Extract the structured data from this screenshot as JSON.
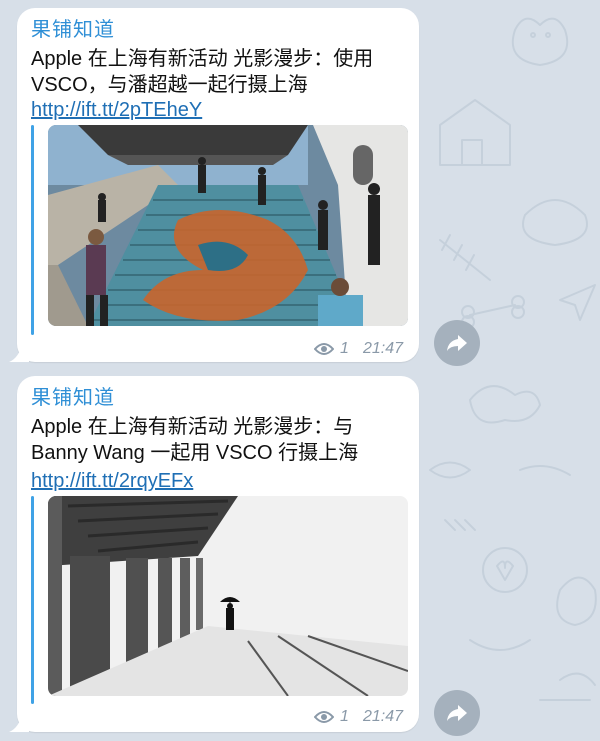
{
  "messages": [
    {
      "sender": "果铺知道",
      "text": "Apple 在上海有新活动 光影漫步：使用 VSCO，与潘超越一起行摄上海",
      "link": "http://ift.tt/2pTEheY",
      "views": "1",
      "time": "21:47",
      "image": "photo-stairs-mural"
    },
    {
      "sender": "果铺知道",
      "text": "Apple 在上海有新活动 光影漫步：与 Banny Wang 一起用 VSCO 行摄上海",
      "link": "http://ift.tt/2rqyEFx",
      "views": "1",
      "time": "21:47",
      "image": "photo-colonnade-umbrella"
    }
  ],
  "colors": {
    "background": "#d7dfe8",
    "sender": "#2f8fd6",
    "link": "#1f6fb5",
    "accent_bar": "#3fa2e6",
    "meta": "#8a99a8",
    "share_button": "#a5b1bd"
  },
  "icons": [
    "eye-icon",
    "share-arrow-icon"
  ]
}
